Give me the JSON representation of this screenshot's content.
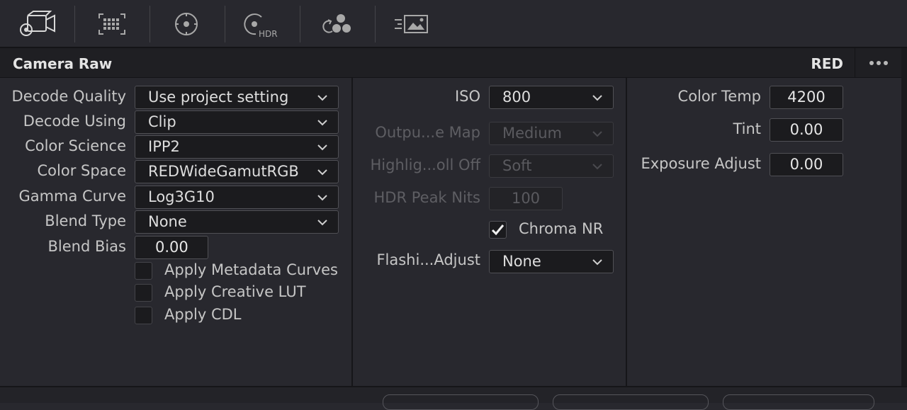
{
  "toolbar": {
    "icons": [
      "camera-raw-icon",
      "color-match-icon",
      "primaries-icon",
      "hdr-icon",
      "rgb-mixer-icon",
      "motion-effects-icon"
    ],
    "hdr_text": "HDR"
  },
  "header": {
    "title": "Camera Raw",
    "format": "RED"
  },
  "left": {
    "decode_quality": {
      "label": "Decode Quality",
      "value": "Use project setting"
    },
    "decode_using": {
      "label": "Decode Using",
      "value": "Clip"
    },
    "color_science": {
      "label": "Color Science",
      "value": "IPP2"
    },
    "color_space": {
      "label": "Color Space",
      "value": "REDWideGamutRGB"
    },
    "gamma_curve": {
      "label": "Gamma Curve",
      "value": "Log3G10"
    },
    "blend_type": {
      "label": "Blend Type",
      "value": "None"
    },
    "blend_bias": {
      "label": "Blend Bias",
      "value": "0.00"
    },
    "apply_metadata_curves": {
      "label": "Apply Metadata Curves",
      "checked": false
    },
    "apply_creative_lut": {
      "label": "Apply Creative LUT",
      "checked": false
    },
    "apply_cdl": {
      "label": "Apply CDL",
      "checked": false
    }
  },
  "middle": {
    "iso": {
      "label": "ISO",
      "value": "800"
    },
    "output_tone_map": {
      "label": "Outpu...e Map",
      "value": "Medium"
    },
    "highlight_rolloff": {
      "label": "Highlig...oll Off",
      "value": "Soft"
    },
    "hdr_peak_nits": {
      "label": "HDR Peak Nits",
      "value": "100"
    },
    "chroma_nr": {
      "label": "Chroma NR",
      "checked": true
    },
    "flashing_adjust": {
      "label": "Flashi...Adjust",
      "value": "None"
    }
  },
  "right": {
    "color_temp": {
      "label": "Color Temp",
      "value": "4200"
    },
    "tint": {
      "label": "Tint",
      "value": "0.00"
    },
    "exposure_adjust": {
      "label": "Exposure Adjust",
      "value": "0.00"
    }
  }
}
